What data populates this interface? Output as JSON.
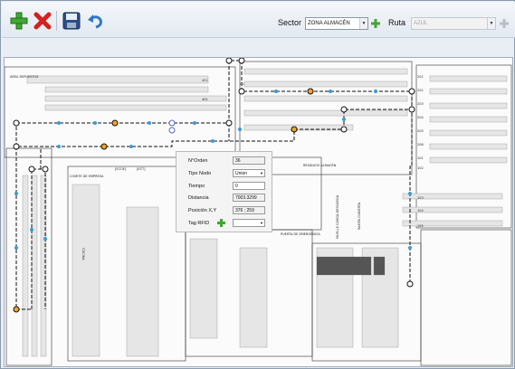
{
  "toolbar": {
    "sector_label": "Sector",
    "sector_value": "ZONA ALMACÉN",
    "route_label": "Ruta",
    "route_value": "AZUL"
  },
  "panel": {
    "fields": [
      {
        "label": "N°Orden",
        "value": "36"
      },
      {
        "label": "Tipo Nodo",
        "value": "Union"
      },
      {
        "label": "Tiempo",
        "value": "0"
      },
      {
        "label": "Distancia",
        "value": "7003.3299"
      },
      {
        "label": "Posición X,Y",
        "value": "376 ; 259"
      },
      {
        "label": "Tag RFID",
        "value": ""
      }
    ]
  },
  "map_labels": {
    "zone_a": "AREA REPUESTOS",
    "room_1": "COMITE DE EMPRESA",
    "room_2": "[ECOE]",
    "room_3": "[ECT]",
    "room_4": "COCINA",
    "room_5": "PUERTA DE EMERGENCIA",
    "room_6": "MUELLE CARGA-DESCARGA",
    "room_7": "RAMPA CUBIERTA",
    "room_8": "RESIDUOS ALMACÉN",
    "r201": "201",
    "r202": "202",
    "r203": "203",
    "r204": "204",
    "r205": "205",
    "r206": "206",
    "r101": "101",
    "r102": "102",
    "r103": "103",
    "r104": "104",
    "r105": "105",
    "r421": "421",
    "r401": "401",
    "r_o1": "O1"
  },
  "colors": {
    "accent": "#3a9ad9",
    "node_orange": "#f5a623",
    "node_dark": "#222222"
  }
}
